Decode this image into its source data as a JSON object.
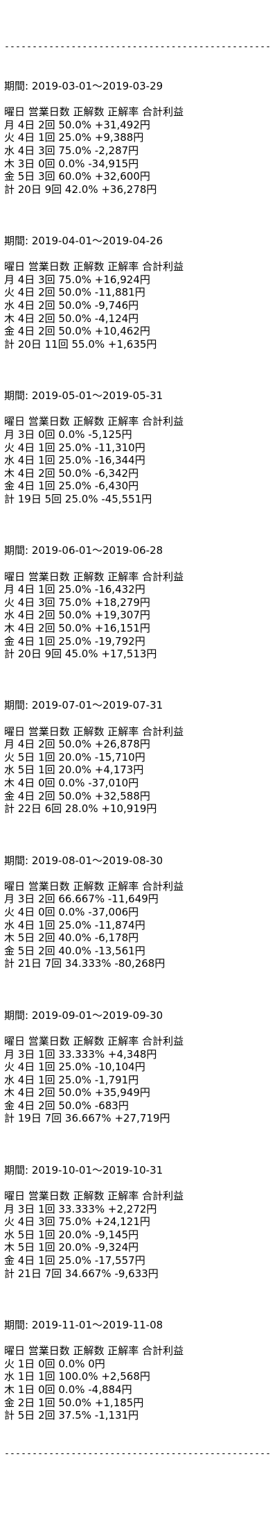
{
  "rule": "------------------------------------------------",
  "header": "曜日 営業日数 正解数 正解率 合計利益",
  "period_label": "期間: ",
  "periods": [
    {
      "range": "2019-03-01～2019-03-29",
      "rows": [
        "月 4日 2回 50.0% +31,492円",
        "火 4日 1回 25.0% +9,388円",
        "水 4日 3回 75.0% -2,287円",
        "木 3日 0回 0.0% -34,915円",
        "金 5日 3回 60.0% +32,600円",
        "計 20日 9回 42.0% +36,278円"
      ]
    },
    {
      "range": "2019-04-01～2019-04-26",
      "rows": [
        "月 4日 3回 75.0% +16,924円",
        "火 4日 2回 50.0% -11,881円",
        "水 4日 2回 50.0% -9,746円",
        "木 4日 2回 50.0% -4,124円",
        "金 4日 2回 50.0% +10,462円",
        "計 20日 11回 55.0% +1,635円"
      ]
    },
    {
      "range": "2019-05-01～2019-05-31",
      "rows": [
        "月 3日 0回 0.0% -5,125円",
        "火 4日 1回 25.0% -11,310円",
        "水 4日 1回 25.0% -16,344円",
        "木 4日 2回 50.0% -6,342円",
        "金 4日 1回 25.0% -6,430円",
        "計 19日 5回 25.0% -45,551円"
      ]
    },
    {
      "range": "2019-06-01～2019-06-28",
      "rows": [
        "月 4日 1回 25.0% -16,432円",
        "火 4日 3回 75.0% +18,279円",
        "水 4日 2回 50.0% +19,307円",
        "木 4日 2回 50.0% +16,151円",
        "金 4日 1回 25.0% -19,792円",
        "計 20日 9回 45.0% +17,513円"
      ]
    },
    {
      "range": "2019-07-01～2019-07-31",
      "rows": [
        "月 4日 2回 50.0% +26,878円",
        "火 5日 1回 20.0% -15,710円",
        "水 5日 1回 20.0% +4,173円",
        "木 4日 0回 0.0% -37,010円",
        "金 4日 2回 50.0% +32,588円",
        "計 22日 6回 28.0% +10,919円"
      ]
    },
    {
      "range": "2019-08-01～2019-08-30",
      "rows": [
        "月 3日 2回 66.667% -11,649円",
        "火 4日 0回 0.0% -37,006円",
        "水 4日 1回 25.0% -11,874円",
        "木 5日 2回 40.0% -6,178円",
        "金 5日 2回 40.0% -13,561円",
        "計 21日 7回 34.333% -80,268円"
      ]
    },
    {
      "range": "2019-09-01～2019-09-30",
      "rows": [
        "月 3日 1回 33.333% +4,348円",
        "火 4日 1回 25.0% -10,104円",
        "水 4日 1回 25.0% -1,791円",
        "木 4日 2回 50.0% +35,949円",
        "金 4日 2回 50.0% -683円",
        "計 19日 7回 36.667% +27,719円"
      ]
    },
    {
      "range": "2019-10-01～2019-10-31",
      "rows": [
        "月 3日 1回 33.333% +2,272円",
        "火 4日 3回 75.0% +24,121円",
        "水 5日 1回 20.0% -9,145円",
        "木 5日 1回 20.0% -9,324円",
        "金 4日 1回 25.0% -17,557円",
        "計 21日 7回 34.667% -9,633円"
      ]
    },
    {
      "range": "2019-11-01～2019-11-08",
      "rows": [
        "火 1日 0回 0.0% 0円",
        "水 1日 1回 100.0% +2,568円",
        "木 1日 0回 0.0% -4,884円",
        "金 2日 1回 50.0% +1,185円",
        "計 5日 2回 37.5% -1,131円"
      ]
    }
  ]
}
